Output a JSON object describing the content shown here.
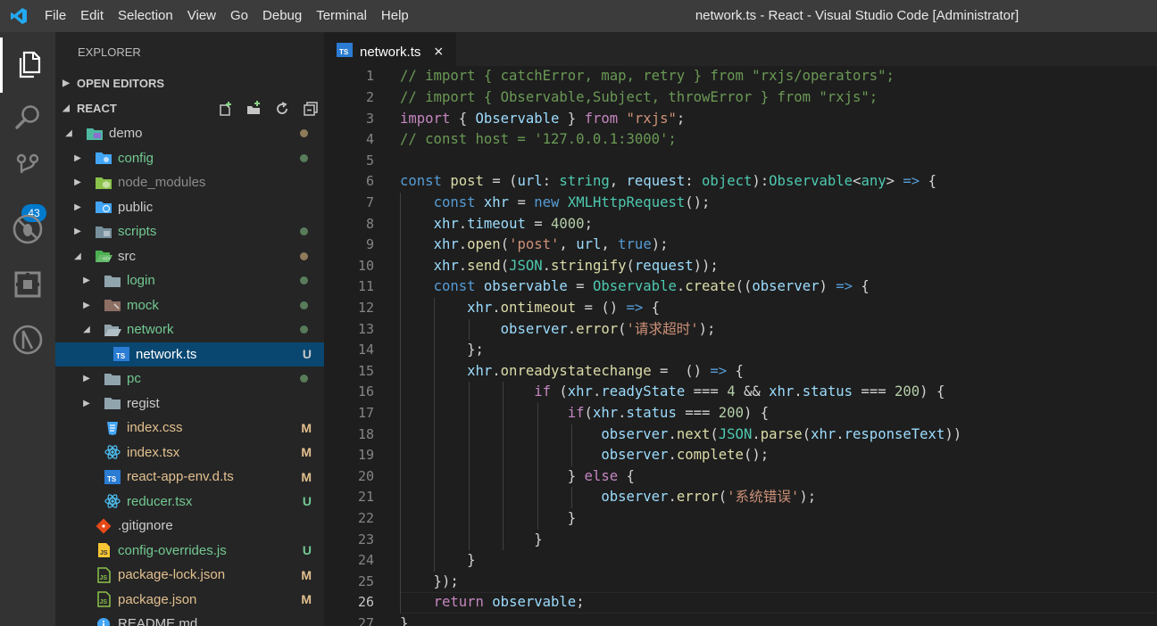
{
  "window": {
    "title": "network.ts - React - Visual Studio Code [Administrator]",
    "menu": [
      "File",
      "Edit",
      "Selection",
      "View",
      "Go",
      "Debug",
      "Terminal",
      "Help"
    ]
  },
  "activity_bar": {
    "items": [
      "explorer-icon",
      "search-icon",
      "source-control-icon",
      "debug-icon",
      "extensions-icon",
      "remote-icon"
    ],
    "scm_badge": "43"
  },
  "sidebar": {
    "title": "EXPLORER",
    "open_editors_label": "OPEN EDITORS",
    "project_label": "REACT",
    "tree": [
      {
        "label": "demo",
        "depth": 1,
        "arrow": "open",
        "icon": "folder-demo",
        "status": "",
        "dot": "#8f7a5a",
        "color": "#cccccc"
      },
      {
        "label": "config",
        "depth": 2,
        "arrow": "closed",
        "icon": "folder-config",
        "status": "",
        "dot": "#587c5a",
        "color": "#73c991"
      },
      {
        "label": "node_modules",
        "depth": 2,
        "arrow": "closed",
        "icon": "folder-node",
        "status": "",
        "dot": "",
        "color": "#8c8c8c"
      },
      {
        "label": "public",
        "depth": 2,
        "arrow": "closed",
        "icon": "folder-public",
        "status": "",
        "dot": "",
        "color": "#cccccc"
      },
      {
        "label": "scripts",
        "depth": 2,
        "arrow": "closed",
        "icon": "folder-scripts",
        "status": "",
        "dot": "#587c5a",
        "color": "#73c991"
      },
      {
        "label": "src",
        "depth": 2,
        "arrow": "open",
        "icon": "folder-src",
        "status": "",
        "dot": "#8f7a5a",
        "color": "#cccccc"
      },
      {
        "label": "login",
        "depth": 3,
        "arrow": "closed",
        "icon": "folder",
        "status": "",
        "dot": "#587c5a",
        "color": "#73c991"
      },
      {
        "label": "mock",
        "depth": 3,
        "arrow": "closed",
        "icon": "folder-mock",
        "status": "",
        "dot": "#587c5a",
        "color": "#73c991"
      },
      {
        "label": "network",
        "depth": 3,
        "arrow": "open",
        "icon": "folder-open",
        "status": "",
        "dot": "#587c5a",
        "color": "#73c991"
      },
      {
        "label": "network.ts",
        "depth": 4,
        "arrow": "",
        "icon": "ts-file",
        "status": "U",
        "dot": "",
        "color": "#ffffff",
        "selected": true
      },
      {
        "label": "pc",
        "depth": 3,
        "arrow": "closed",
        "icon": "folder",
        "status": "",
        "dot": "#587c5a",
        "color": "#73c991"
      },
      {
        "label": "regist",
        "depth": 3,
        "arrow": "closed",
        "icon": "folder",
        "status": "",
        "dot": "",
        "color": "#cccccc"
      },
      {
        "label": "index.css",
        "depth": 3,
        "arrow": "",
        "icon": "css-file",
        "status": "M",
        "dot": "",
        "color": "#e2c08d"
      },
      {
        "label": "index.tsx",
        "depth": 3,
        "arrow": "",
        "icon": "react-file",
        "status": "M",
        "dot": "",
        "color": "#e2c08d"
      },
      {
        "label": "react-app-env.d.ts",
        "depth": 3,
        "arrow": "",
        "icon": "ts-file",
        "status": "M",
        "dot": "",
        "color": "#e2c08d"
      },
      {
        "label": "reducer.tsx",
        "depth": 3,
        "arrow": "",
        "icon": "react-file",
        "status": "U",
        "dot": "",
        "color": "#73c991"
      },
      {
        "label": ".gitignore",
        "depth": 2,
        "arrow": "",
        "icon": "git-file",
        "status": "",
        "dot": "",
        "color": "#cccccc"
      },
      {
        "label": "config-overrides.js",
        "depth": 2,
        "arrow": "",
        "icon": "js-file",
        "status": "U",
        "dot": "",
        "color": "#73c991"
      },
      {
        "label": "package-lock.json",
        "depth": 2,
        "arrow": "",
        "icon": "json-file",
        "status": "M",
        "dot": "",
        "color": "#e2c08d"
      },
      {
        "label": "package.json",
        "depth": 2,
        "arrow": "",
        "icon": "json-file",
        "status": "M",
        "dot": "",
        "color": "#e2c08d"
      },
      {
        "label": "README.md",
        "depth": 2,
        "arrow": "",
        "icon": "info-file",
        "status": "",
        "dot": "",
        "color": "#cccccc"
      }
    ]
  },
  "editor": {
    "tab": {
      "label": "network.ts",
      "close": "×"
    },
    "active_line": 26,
    "lines": [
      [
        [
          "cm",
          "// import { catchError, map, retry } from \"rxjs/operators\";"
        ]
      ],
      [
        [
          "cm",
          "// import { Observable,Subject, throwError } from \"rxjs\";"
        ]
      ],
      [
        [
          "ck",
          "import"
        ],
        [
          "pl",
          " { "
        ],
        [
          "var",
          "Observable"
        ],
        [
          "pl",
          " } "
        ],
        [
          "ck",
          "from"
        ],
        [
          "pl",
          " "
        ],
        [
          "str",
          "\"rxjs\""
        ],
        [
          "pl",
          ";"
        ]
      ],
      [
        [
          "cm",
          "// const host = '127.0.0.1:3000';"
        ]
      ],
      [],
      [
        [
          "kw",
          "const"
        ],
        [
          "pl",
          " "
        ],
        [
          "fn",
          "post"
        ],
        [
          "pl",
          " = ("
        ],
        [
          "var",
          "url"
        ],
        [
          "pl",
          ": "
        ],
        [
          "type",
          "string"
        ],
        [
          "pl",
          ", "
        ],
        [
          "var",
          "request"
        ],
        [
          "pl",
          ": "
        ],
        [
          "type",
          "object"
        ],
        [
          "pl",
          "):"
        ],
        [
          "type",
          "Observable"
        ],
        [
          "pl",
          "<"
        ],
        [
          "type",
          "any"
        ],
        [
          "pl",
          "> "
        ],
        [
          "kw",
          "=>"
        ],
        [
          "pl",
          " {"
        ]
      ],
      [
        [
          "pl",
          "    "
        ],
        [
          "kw",
          "const"
        ],
        [
          "pl",
          " "
        ],
        [
          "var",
          "xhr"
        ],
        [
          "pl",
          " = "
        ],
        [
          "kw",
          "new"
        ],
        [
          "pl",
          " "
        ],
        [
          "type",
          "XMLHttpRequest"
        ],
        [
          "pl",
          "();"
        ]
      ],
      [
        [
          "pl",
          "    "
        ],
        [
          "var",
          "xhr"
        ],
        [
          "pl",
          "."
        ],
        [
          "var",
          "timeout"
        ],
        [
          "pl",
          " = "
        ],
        [
          "num",
          "4000"
        ],
        [
          "pl",
          ";"
        ]
      ],
      [
        [
          "pl",
          "    "
        ],
        [
          "var",
          "xhr"
        ],
        [
          "pl",
          "."
        ],
        [
          "fn",
          "open"
        ],
        [
          "pl",
          "("
        ],
        [
          "str",
          "'post'"
        ],
        [
          "pl",
          ", "
        ],
        [
          "var",
          "url"
        ],
        [
          "pl",
          ", "
        ],
        [
          "kw",
          "true"
        ],
        [
          "pl",
          ");"
        ]
      ],
      [
        [
          "pl",
          "    "
        ],
        [
          "var",
          "xhr"
        ],
        [
          "pl",
          "."
        ],
        [
          "fn",
          "send"
        ],
        [
          "pl",
          "("
        ],
        [
          "type",
          "JSON"
        ],
        [
          "pl",
          "."
        ],
        [
          "fn",
          "stringify"
        ],
        [
          "pl",
          "("
        ],
        [
          "var",
          "request"
        ],
        [
          "pl",
          "));"
        ]
      ],
      [
        [
          "pl",
          "    "
        ],
        [
          "kw",
          "const"
        ],
        [
          "pl",
          " "
        ],
        [
          "var",
          "observable"
        ],
        [
          "pl",
          " = "
        ],
        [
          "type",
          "Observable"
        ],
        [
          "pl",
          "."
        ],
        [
          "fn",
          "create"
        ],
        [
          "pl",
          "(("
        ],
        [
          "var",
          "observer"
        ],
        [
          "pl",
          ") "
        ],
        [
          "kw",
          "=>"
        ],
        [
          "pl",
          " {"
        ]
      ],
      [
        [
          "pl",
          "        "
        ],
        [
          "var",
          "xhr"
        ],
        [
          "pl",
          "."
        ],
        [
          "fn",
          "ontimeout"
        ],
        [
          "pl",
          " = () "
        ],
        [
          "kw",
          "=>"
        ],
        [
          "pl",
          " {"
        ]
      ],
      [
        [
          "pl",
          "            "
        ],
        [
          "var",
          "observer"
        ],
        [
          "pl",
          "."
        ],
        [
          "fn",
          "error"
        ],
        [
          "pl",
          "("
        ],
        [
          "str",
          "'请求超时'"
        ],
        [
          "pl",
          ");"
        ]
      ],
      [
        [
          "pl",
          "        };"
        ]
      ],
      [
        [
          "pl",
          "        "
        ],
        [
          "var",
          "xhr"
        ],
        [
          "pl",
          "."
        ],
        [
          "fn",
          "onreadystatechange"
        ],
        [
          "pl",
          " =  () "
        ],
        [
          "kw",
          "=>"
        ],
        [
          "pl",
          " {"
        ]
      ],
      [
        [
          "pl",
          "                "
        ],
        [
          "ck",
          "if"
        ],
        [
          "pl",
          " ("
        ],
        [
          "var",
          "xhr"
        ],
        [
          "pl",
          "."
        ],
        [
          "var",
          "readyState"
        ],
        [
          "pl",
          " === "
        ],
        [
          "num",
          "4"
        ],
        [
          "pl",
          " && "
        ],
        [
          "var",
          "xhr"
        ],
        [
          "pl",
          "."
        ],
        [
          "var",
          "status"
        ],
        [
          "pl",
          " === "
        ],
        [
          "num",
          "200"
        ],
        [
          "pl",
          ") {"
        ]
      ],
      [
        [
          "pl",
          "                    "
        ],
        [
          "ck",
          "if"
        ],
        [
          "pl",
          "("
        ],
        [
          "var",
          "xhr"
        ],
        [
          "pl",
          "."
        ],
        [
          "var",
          "status"
        ],
        [
          "pl",
          " === "
        ],
        [
          "num",
          "200"
        ],
        [
          "pl",
          ") {"
        ]
      ],
      [
        [
          "pl",
          "                        "
        ],
        [
          "var",
          "observer"
        ],
        [
          "pl",
          "."
        ],
        [
          "fn",
          "next"
        ],
        [
          "pl",
          "("
        ],
        [
          "type",
          "JSON"
        ],
        [
          "pl",
          "."
        ],
        [
          "fn",
          "parse"
        ],
        [
          "pl",
          "("
        ],
        [
          "var",
          "xhr"
        ],
        [
          "pl",
          "."
        ],
        [
          "var",
          "responseText"
        ],
        [
          "pl",
          "))"
        ]
      ],
      [
        [
          "pl",
          "                        "
        ],
        [
          "var",
          "observer"
        ],
        [
          "pl",
          "."
        ],
        [
          "fn",
          "complete"
        ],
        [
          "pl",
          "();"
        ]
      ],
      [
        [
          "pl",
          "                    } "
        ],
        [
          "ck",
          "else"
        ],
        [
          "pl",
          " {"
        ]
      ],
      [
        [
          "pl",
          "                        "
        ],
        [
          "var",
          "observer"
        ],
        [
          "pl",
          "."
        ],
        [
          "fn",
          "error"
        ],
        [
          "pl",
          "("
        ],
        [
          "str",
          "'系统错误'"
        ],
        [
          "pl",
          ");"
        ]
      ],
      [
        [
          "pl",
          "                    }"
        ]
      ],
      [
        [
          "pl",
          "                }"
        ]
      ],
      [
        [
          "pl",
          "        }"
        ]
      ],
      [
        [
          "pl",
          "    });"
        ]
      ],
      [
        [
          "pl",
          "    "
        ],
        [
          "ck",
          "return"
        ],
        [
          "pl",
          " "
        ],
        [
          "var",
          "observable"
        ],
        [
          "pl",
          ";"
        ]
      ],
      [
        [
          "pl",
          "}"
        ]
      ]
    ]
  }
}
